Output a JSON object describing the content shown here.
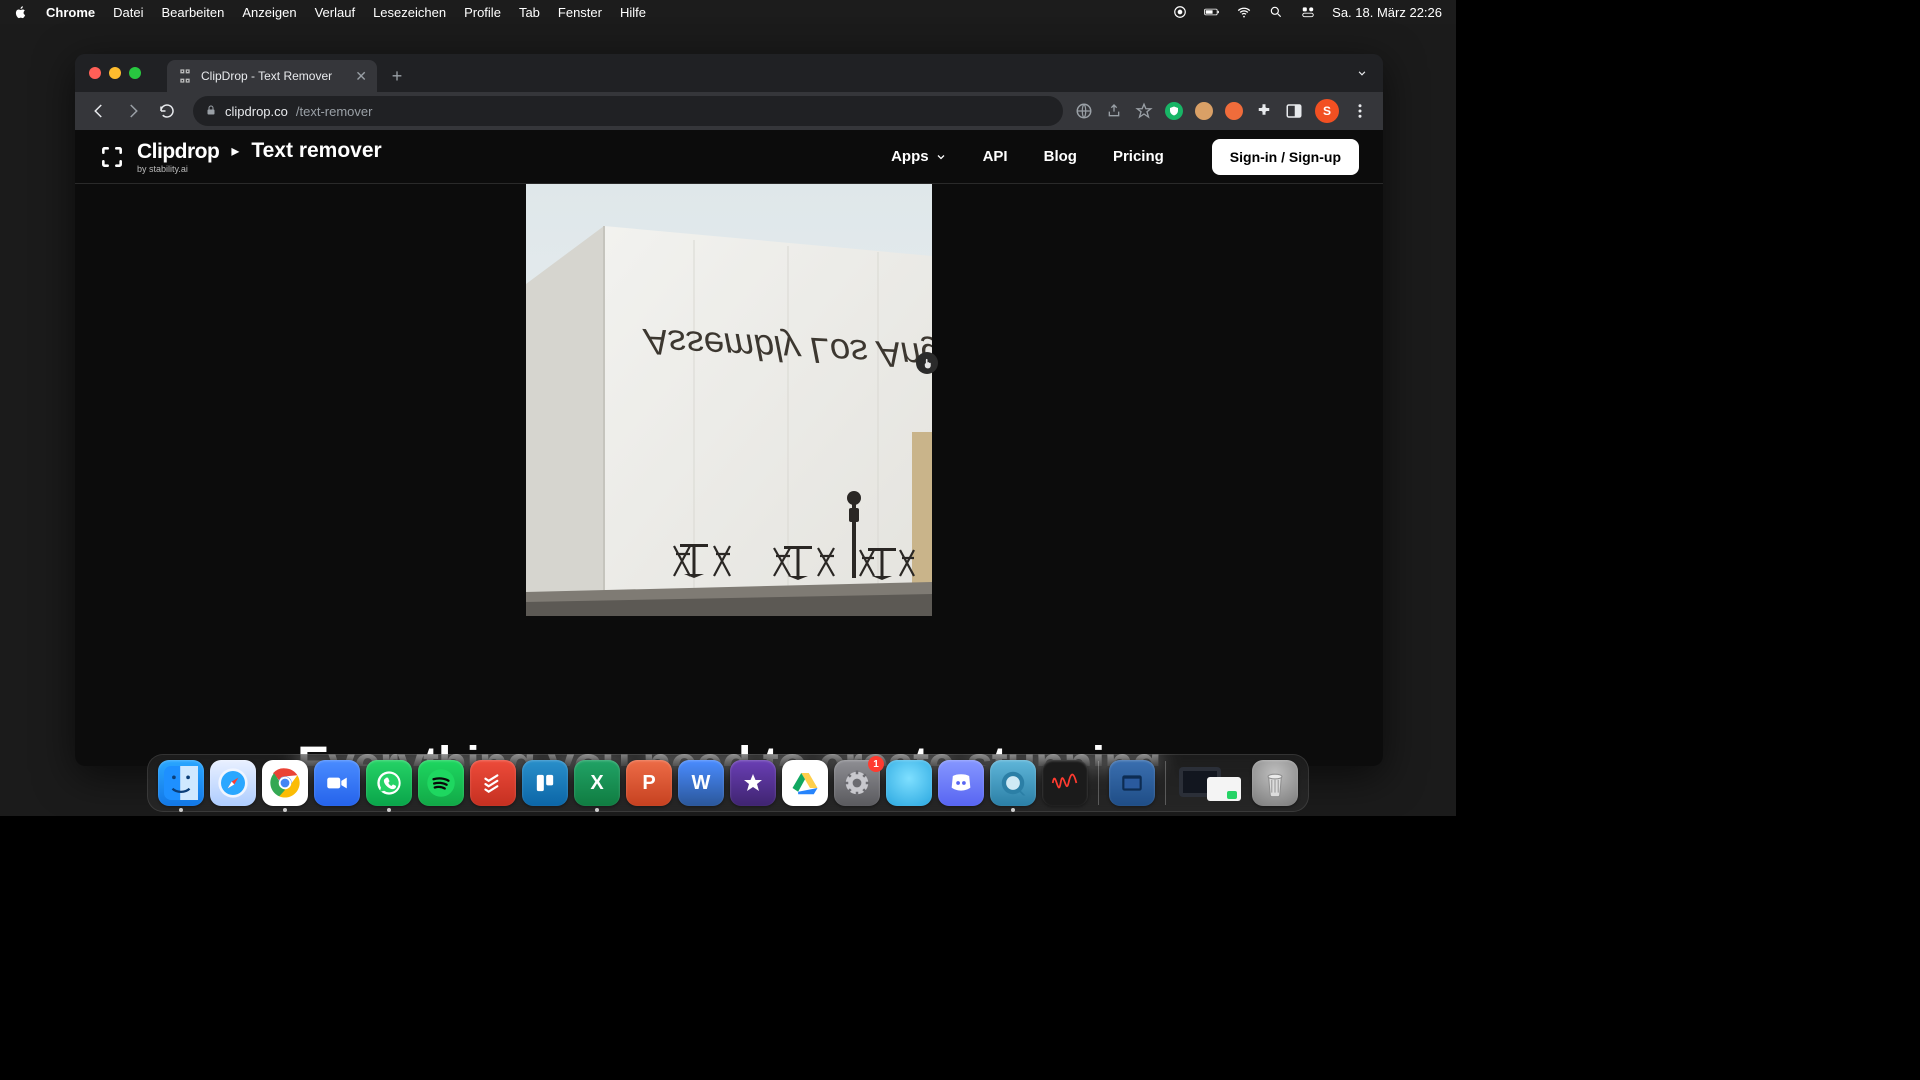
{
  "menubar": {
    "app": "Chrome",
    "items": [
      "Datei",
      "Bearbeiten",
      "Anzeigen",
      "Verlauf",
      "Lesezeichen",
      "Profile",
      "Tab",
      "Fenster",
      "Hilfe"
    ],
    "datetime": "Sa. 18. März  22:26"
  },
  "browser": {
    "tab_title": "ClipDrop - Text Remover",
    "url_domain": "clipdrop.co",
    "url_path": "/text-remover",
    "avatar_initial": "S"
  },
  "clipdrop": {
    "brand": "Clipdrop",
    "brand_sub": "by stability.ai",
    "tool": "Text remover",
    "nav": {
      "apps": "Apps",
      "api": "API",
      "blog": "Blog",
      "pricing": "Pricing"
    },
    "signin": "Sign-in / Sign-up",
    "image_text": "Assembly Los Angeles",
    "tagline": "Everything you need to create stunning"
  },
  "dock": {
    "apps": [
      {
        "name": "finder",
        "bg": "linear-gradient(#2aa7ff,#1277e6)",
        "label": "",
        "running": true
      },
      {
        "name": "safari",
        "bg": "linear-gradient(#e9f0ff,#aecdff)",
        "label": "",
        "running": false
      },
      {
        "name": "chrome",
        "bg": "#fff",
        "label": "",
        "running": true
      },
      {
        "name": "zoom",
        "bg": "linear-gradient(#4a8cff,#2563eb)",
        "label": "",
        "running": false
      },
      {
        "name": "whatsapp",
        "bg": "linear-gradient(#25d366,#0aa54a)",
        "label": "",
        "running": true
      },
      {
        "name": "spotify",
        "bg": "linear-gradient(#1ed760,#12a847)",
        "label": "",
        "running": false
      },
      {
        "name": "todoist",
        "bg": "linear-gradient(#ed4b3a,#c53021)",
        "label": "",
        "running": false
      },
      {
        "name": "trello",
        "bg": "linear-gradient(#298fca,#0c66a7)",
        "label": "",
        "running": false
      },
      {
        "name": "excel",
        "bg": "linear-gradient(#21a366,#107c41)",
        "label": "X",
        "running": true
      },
      {
        "name": "powerpoint",
        "bg": "linear-gradient(#ed6c47,#c64120)",
        "label": "P",
        "running": false
      },
      {
        "name": "word",
        "bg": "linear-gradient(#4a8cff,#2b579a)",
        "label": "W",
        "running": false
      },
      {
        "name": "imovie",
        "bg": "linear-gradient(#6a3fb5,#3f2470)",
        "label": "★",
        "running": false
      },
      {
        "name": "google-drive",
        "bg": "#fff",
        "label": "",
        "running": false
      },
      {
        "name": "settings",
        "bg": "linear-gradient(#8e8e93,#5a5a5e)",
        "label": "",
        "running": false,
        "badge": "1"
      },
      {
        "name": "sky",
        "bg": "radial-gradient(circle at 50% 40%, #7edfff, #2aa7e0)",
        "label": "",
        "running": false
      },
      {
        "name": "discord",
        "bg": "linear-gradient(#8697ff,#5865f2)",
        "label": "",
        "running": false
      },
      {
        "name": "quicktime",
        "bg": "linear-gradient(#5fb6d9,#2b7fa6)",
        "label": "",
        "running": true
      },
      {
        "name": "voice-memos",
        "bg": "#1b1b1b",
        "label": "",
        "running": false
      }
    ]
  }
}
